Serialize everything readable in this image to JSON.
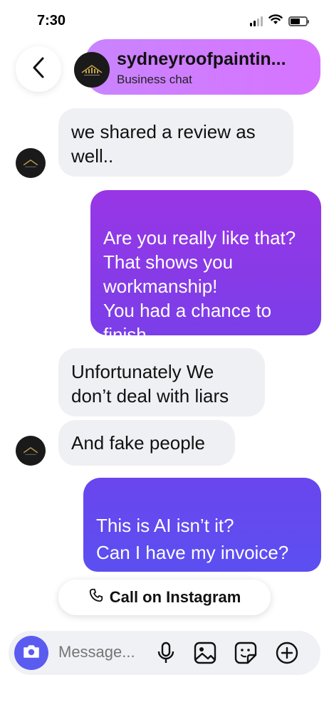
{
  "status_bar": {
    "time": "7:30",
    "icons": [
      "signal-icon",
      "wifi-icon",
      "battery-icon"
    ]
  },
  "header": {
    "back_icon": "chevron-left-icon",
    "name": "sydneyroofpaintin...",
    "subtitle": "Business chat",
    "highlight_color": "#c06fff"
  },
  "messages": [
    {
      "direction": "in",
      "text": "we shared a review as well.."
    },
    {
      "direction": "out",
      "text": "Are you really like that? That shows you workmanship!\nYou had a chance to finish"
    },
    {
      "direction": "in",
      "text": "Unfortunately We don’t deal with liars"
    },
    {
      "direction": "in",
      "text": "And fake people"
    },
    {
      "direction": "out",
      "text": "This is AI isn’t it?\nCan I have my invoice?\nShow me your review"
    }
  ],
  "call_button": {
    "label": "Call on Instagram",
    "icon": "phone-icon"
  },
  "composer": {
    "placeholder": "Message...",
    "icons": [
      "camera-icon",
      "microphone-icon",
      "gallery-icon",
      "sticker-icon",
      "plus-icon"
    ]
  },
  "colors": {
    "incoming_bubble": "#eff0f4",
    "outgoing_gradient_top": "#9a35e8",
    "outgoing_gradient_bottom": "#5e4ef0",
    "camera_button": "#5a5cf0"
  }
}
